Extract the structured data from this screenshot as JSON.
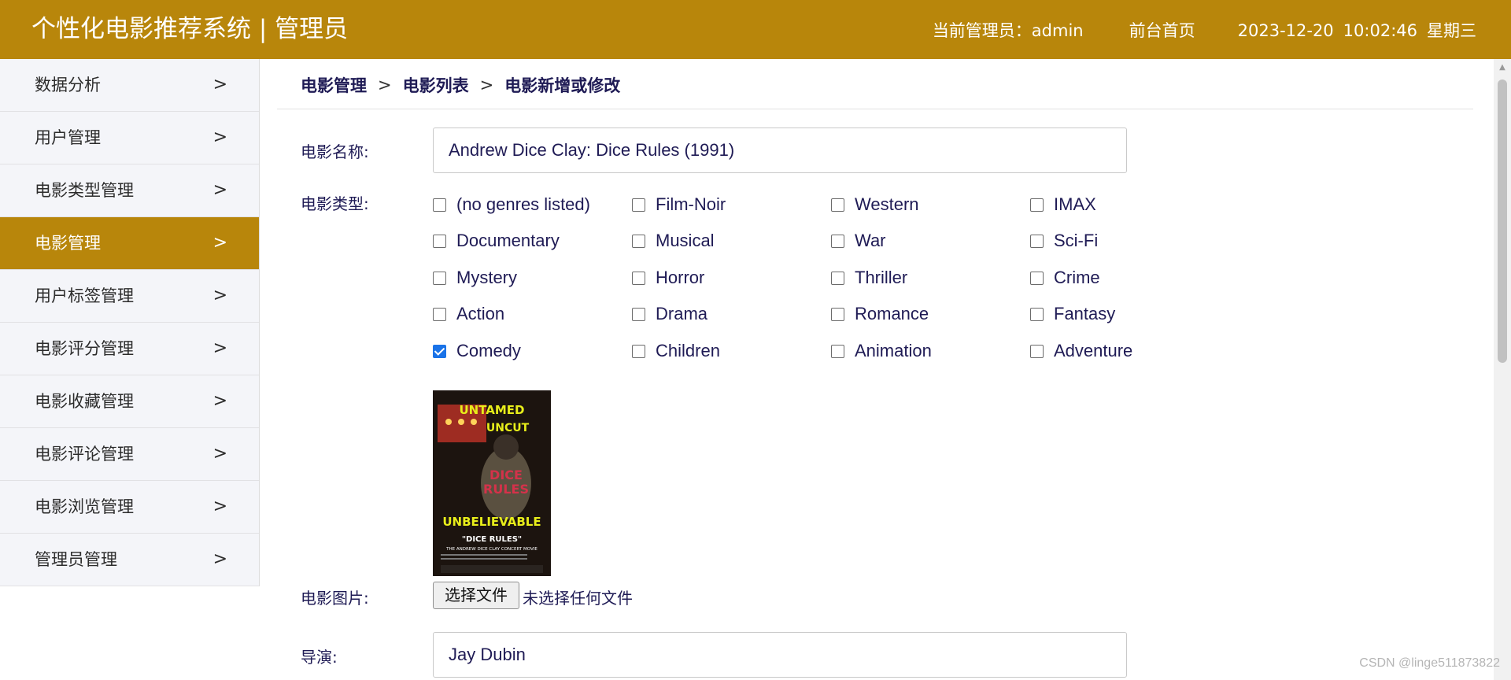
{
  "header": {
    "title": "个性化电影推荐系统 | 管理员",
    "admin_label": "当前管理员：admin",
    "home_link": "前台首页",
    "date": "2023-12-20",
    "time": "10:02:46",
    "weekday": "星期三",
    "bg_color": "#b8860b"
  },
  "sidebar": {
    "items": [
      {
        "label": "数据分析"
      },
      {
        "label": "用户管理"
      },
      {
        "label": "电影类型管理"
      },
      {
        "label": "电影管理"
      },
      {
        "label": "用户标签管理"
      },
      {
        "label": "电影评分管理"
      },
      {
        "label": "电影收藏管理"
      },
      {
        "label": "电影评论管理"
      },
      {
        "label": "电影浏览管理"
      },
      {
        "label": "管理员管理"
      }
    ],
    "active_label": "电影管理",
    "chevron": ">"
  },
  "breadcrumb": {
    "items": [
      "电影管理",
      "电影列表",
      "电影新增或修改"
    ],
    "separator": ">"
  },
  "form": {
    "name_label": "电影名称:",
    "name_value": "Andrew Dice Clay: Dice Rules (1991)",
    "genre_label": "电影类型:",
    "genres": [
      {
        "label": "(no genres listed)",
        "checked": false
      },
      {
        "label": "Film-Noir",
        "checked": false
      },
      {
        "label": "Western",
        "checked": false
      },
      {
        "label": "IMAX",
        "checked": false
      },
      {
        "label": "Documentary",
        "checked": false
      },
      {
        "label": "Musical",
        "checked": false
      },
      {
        "label": "War",
        "checked": false
      },
      {
        "label": "Sci-Fi",
        "checked": false
      },
      {
        "label": "Mystery",
        "checked": false
      },
      {
        "label": "Horror",
        "checked": false
      },
      {
        "label": "Thriller",
        "checked": false
      },
      {
        "label": "Crime",
        "checked": false
      },
      {
        "label": "Action",
        "checked": false
      },
      {
        "label": "Drama",
        "checked": false
      },
      {
        "label": "Romance",
        "checked": false
      },
      {
        "label": "Fantasy",
        "checked": false
      },
      {
        "label": "Comedy",
        "checked": true
      },
      {
        "label": "Children",
        "checked": false
      },
      {
        "label": "Animation",
        "checked": false
      },
      {
        "label": "Adventure",
        "checked": false
      }
    ],
    "image_label": "电影图片:",
    "poster": {
      "line1": "UNTAMED",
      "line2": "UNCUT",
      "line3": "DICE",
      "line4": "RULES",
      "line5": "UNBELIEVABLE",
      "line6": "\"DICE RULES\"",
      "line7": "THE ANDREW DICE CLAY CONCERT MOVIE"
    },
    "file_button": "选择文件",
    "file_status": "未选择任何文件",
    "director_label": "导演:",
    "director_value": "Jay Dubin"
  },
  "watermark": "CSDN @linge511873822"
}
